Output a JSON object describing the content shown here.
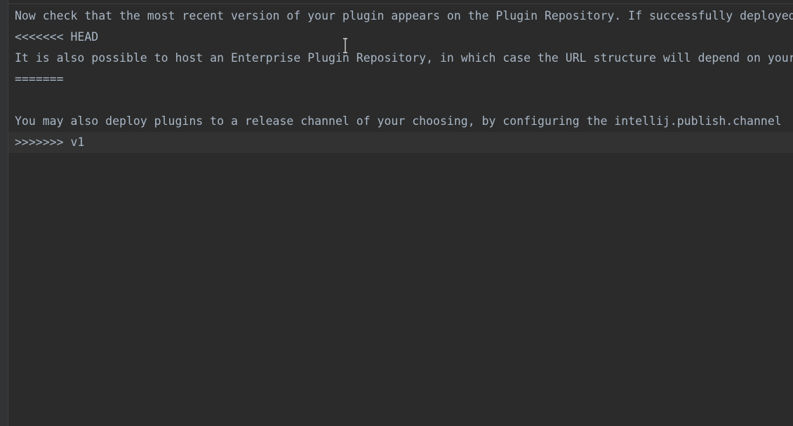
{
  "editor": {
    "lines": [
      "Now check that the most recent version of your plugin appears on the Plugin Repository. If successfully deployed",
      "<<<<<<< HEAD",
      "It is also possible to host an Enterprise Plugin Repository, in which case the URL structure will depend on your",
      "=======",
      "",
      "You may also deploy plugins to a release channel of your choosing, by configuring the intellij.publish.channel",
      ">>>>>>> v1"
    ]
  }
}
